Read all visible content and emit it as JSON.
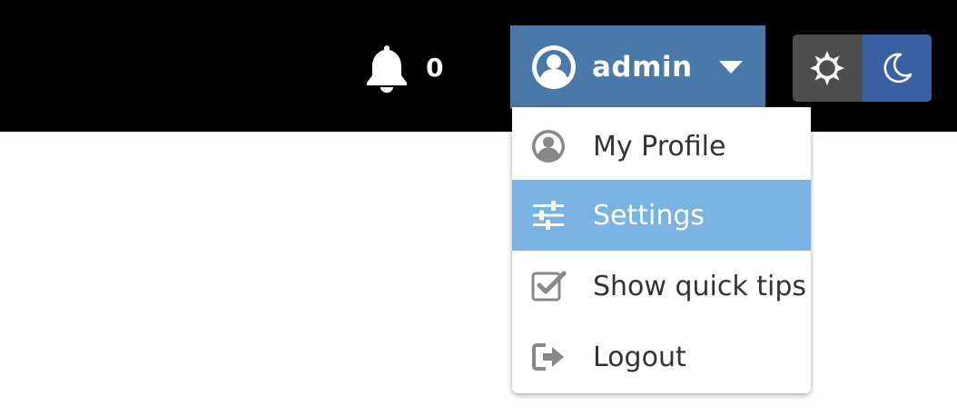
{
  "colors": {
    "topbar_bg": "#000000",
    "user_button_bg": "#4a78a8",
    "menu_highlight": "#7ab2e2",
    "theme_light_bg": "#4d4d4d",
    "theme_dark_bg": "#3b5fa3"
  },
  "header": {
    "notifications": {
      "icon": "bell-icon",
      "count": "0"
    },
    "user": {
      "icon": "user-circle-icon",
      "name": "admin",
      "caret_icon": "caret-down-icon"
    },
    "theme_toggle": {
      "light_icon": "sun-icon",
      "dark_icon": "moon-icon",
      "active": "dark"
    }
  },
  "user_menu": {
    "items": [
      {
        "label": "My Profile",
        "icon": "user-circle-icon"
      },
      {
        "label": "Settings",
        "icon": "sliders-icon",
        "active": true
      },
      {
        "label": "Show quick tips",
        "icon": "checkbox-icon"
      },
      {
        "label": "Logout",
        "icon": "logout-icon"
      }
    ]
  }
}
